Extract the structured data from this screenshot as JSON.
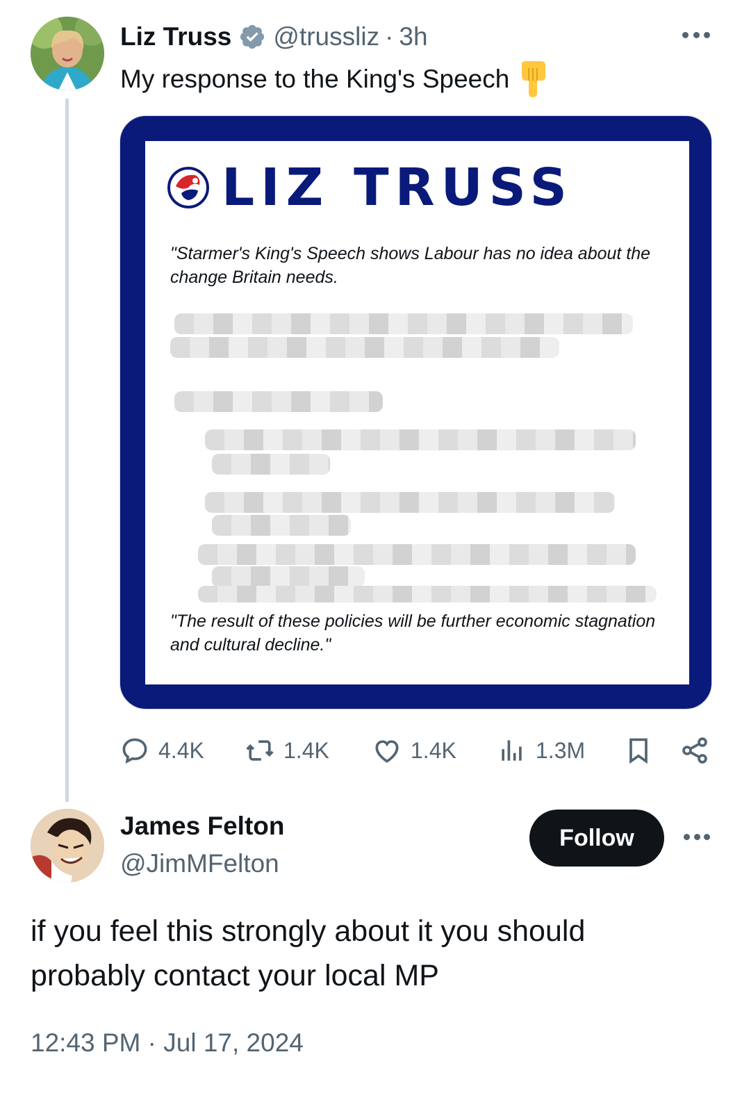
{
  "parent_tweet": {
    "author_name": "Liz Truss",
    "handle": "@trussliz",
    "separator": "·",
    "time_ago": "3h",
    "text": "My response to the King's Speech",
    "emoji_icon": "pointing-down-hand-icon",
    "media": {
      "brand_text": "LIZ TRUSS",
      "brand_color": "#0a1a7a",
      "quote_1": "\"Starmer's King's Speech shows Labour has no idea about the change Britain needs.",
      "quote_2": "\"The result of these policies will be further economic stagnation and cultural decline.\""
    },
    "actions": {
      "replies": "4.4K",
      "reposts": "1.4K",
      "likes": "1.4K",
      "views": "1.3M"
    }
  },
  "reply_tweet": {
    "author_name": "James Felton",
    "handle": "@JimMFelton",
    "follow_label": "Follow",
    "text": "if you feel this strongly about it you should probably contact your local MP",
    "timestamp": "12:43 PM · Jul 17, 2024"
  },
  "colors": {
    "text_primary": "#0f1419",
    "text_secondary": "#536471",
    "verified_badge": "#829aab",
    "follow_bg": "#0f1419"
  }
}
